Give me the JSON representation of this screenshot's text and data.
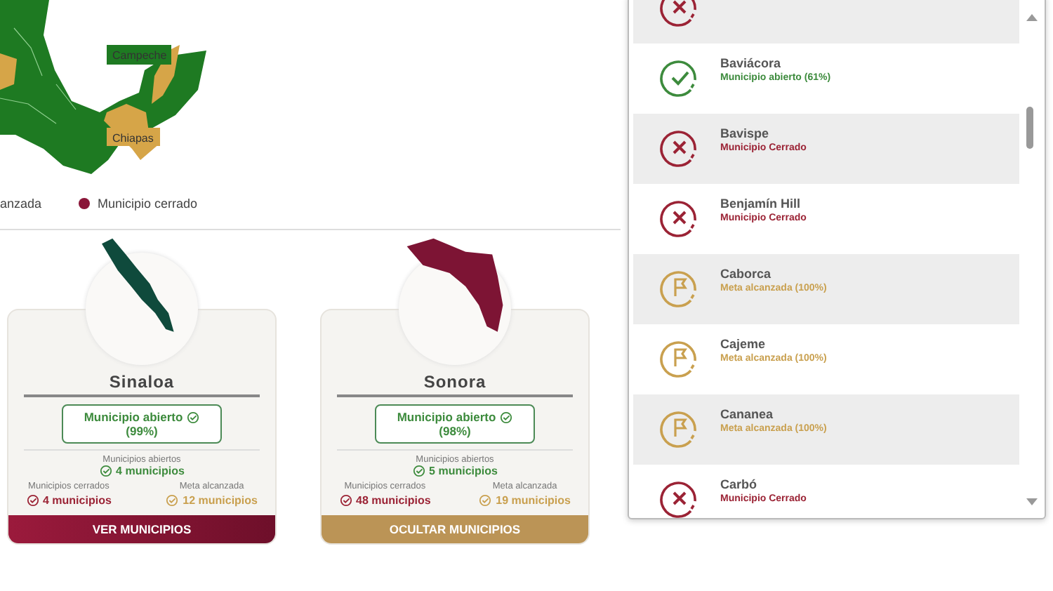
{
  "map": {
    "labels": [
      {
        "text": "Campeche"
      },
      {
        "text": "Chiapas"
      }
    ]
  },
  "legend": [
    {
      "label": "anzada"
    },
    {
      "label": "Municipio cerrado",
      "color": "#8a1538"
    }
  ],
  "states": [
    {
      "name": "Sinaloa",
      "color": "#0f4a3c",
      "status": "Municipio abierto",
      "percent": "(99%)",
      "open_label": "Municipios abiertos",
      "open_count": "4 municipios",
      "closed_label": "Municipios cerrados",
      "closed_count": "4 municipios",
      "goal_label": "Meta alcanzada",
      "goal_count": "12 municipios",
      "button": {
        "label": "VER MUNICIPIOS",
        "kind": "show"
      }
    },
    {
      "name": "Sonora",
      "color": "#7d1434",
      "status": "Municipio abierto",
      "percent": "(98%)",
      "open_label": "Municipios abiertos",
      "open_count": "5 municipios",
      "closed_label": "Municipios cerrados",
      "closed_count": "48 municipios",
      "goal_label": "Meta alcanzada",
      "goal_count": "19 municipios",
      "button": {
        "label": "OCULTAR MUNICIPIOS",
        "kind": "hide"
      }
    }
  ],
  "municipalities": [
    {
      "kind": "closed"
    },
    {
      "kind": "open",
      "name": "Baviácora",
      "status": "Municipio abierto (61%)"
    },
    {
      "kind": "closed",
      "name": "Bavispe",
      "status": "Municipio Cerrado"
    },
    {
      "kind": "closed",
      "name": "Benjamín Hill",
      "status": "Municipio Cerrado"
    },
    {
      "kind": "goal",
      "name": "Caborca",
      "status": "Meta alcanzada (100%)"
    },
    {
      "kind": "goal",
      "name": "Cajeme",
      "status": "Meta alcanzada (100%)"
    },
    {
      "kind": "goal",
      "name": "Cananea",
      "status": "Meta alcanzada (100%)"
    },
    {
      "kind": "closed",
      "name": "Carbó",
      "status": "Municipio Cerrado"
    }
  ]
}
